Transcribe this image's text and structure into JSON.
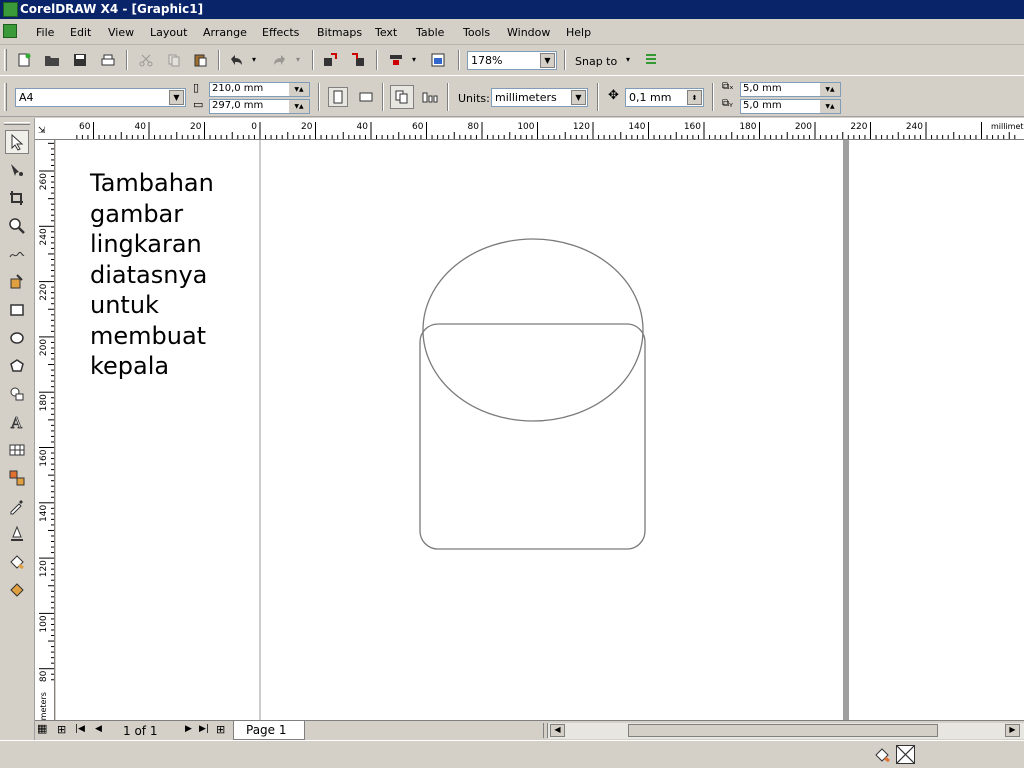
{
  "window": {
    "title": "CorelDRAW X4 - [Graphic1]"
  },
  "menu": [
    "File",
    "Edit",
    "View",
    "Layout",
    "Arrange",
    "Effects",
    "Bitmaps",
    "Text",
    "Table",
    "Tools",
    "Window",
    "Help"
  ],
  "toolbar": {
    "zoom": "178%",
    "snap_to": "Snap to"
  },
  "property_bar": {
    "paper_size": "A4",
    "width": "210,0 mm",
    "height": "297,0 mm",
    "units_label": "Units:",
    "units": "millimeters",
    "nudge": "0,1 mm",
    "dup_x": "5,0 mm",
    "dup_y": "5,0 mm"
  },
  "rulers": {
    "horizontal_labels": [
      "60",
      "40",
      "20",
      "0",
      "20",
      "40",
      "60",
      "80",
      "100",
      "120",
      "140",
      "160",
      "180",
      "200",
      "220",
      "240",
      "millimet"
    ],
    "vertical_labels": [
      "260",
      "240",
      "220",
      "200",
      "180",
      "160",
      "140",
      "120",
      "100",
      "80",
      "millimeters"
    ]
  },
  "canvas": {
    "annotation": "Tambahan\ngambar\nlingkaran\ndiatasnya\nuntuk\nmembuat\nkepala"
  },
  "page_nav": {
    "count": "1 of 1",
    "tab": "Page 1"
  },
  "colors": {
    "titlebar": "#0a246a",
    "chrome": "#d4d0c8",
    "shape_stroke": "#7a7a7a"
  }
}
